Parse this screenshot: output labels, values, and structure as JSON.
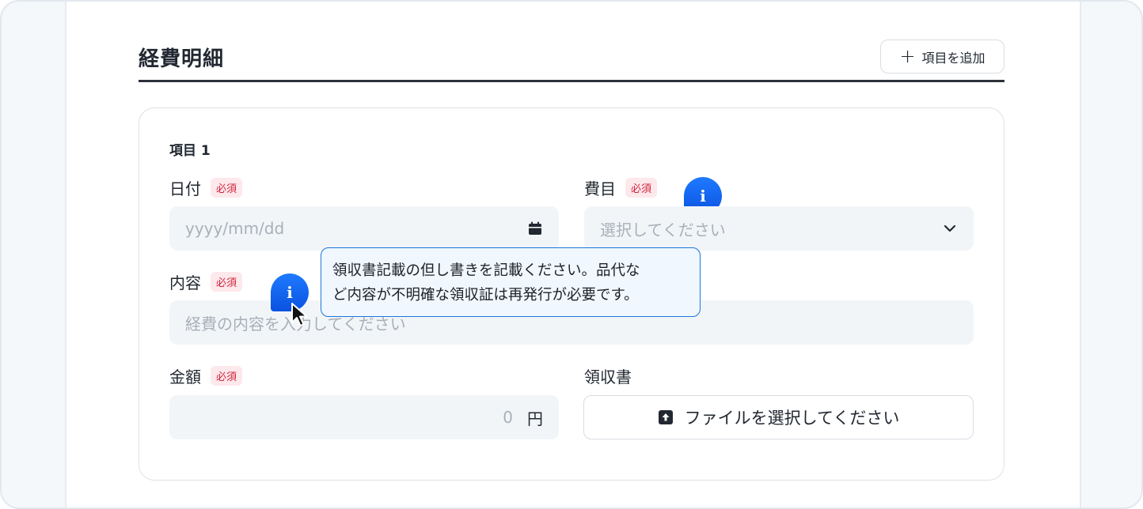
{
  "section": {
    "title": "経費明細",
    "add_button": {
      "icon": "plus-icon",
      "label": "項目を追加"
    }
  },
  "item": {
    "heading": "項目 1",
    "required_badge": "必須",
    "date": {
      "label": "日付",
      "placeholder": "yyyy/mm/dd",
      "icon": "calendar-icon"
    },
    "category": {
      "label": "費目",
      "placeholder": "選択してください",
      "icon": "chevron-down-icon"
    },
    "description": {
      "label": "内容",
      "placeholder": "経費の内容を入力してください"
    },
    "amount": {
      "label": "金額",
      "value": "0",
      "unit": "円"
    },
    "receipt": {
      "label": "領収書",
      "button_label": "ファイルを選択してください",
      "icon": "upload-icon"
    }
  },
  "tooltip": {
    "line1": "領収書記載の但し書きを記載ください。品代な",
    "line2": "ど内容が不明確な領収証は再発行が必要です。"
  },
  "info_icon_glyph": "i",
  "colors": {
    "accent": "#1677ff",
    "required": "#d0233a",
    "required_bg": "#fde8ec",
    "field_bg": "#f2f5f8",
    "tooltip_border": "#1b76d8",
    "tooltip_bg": "#f0f7ff"
  }
}
